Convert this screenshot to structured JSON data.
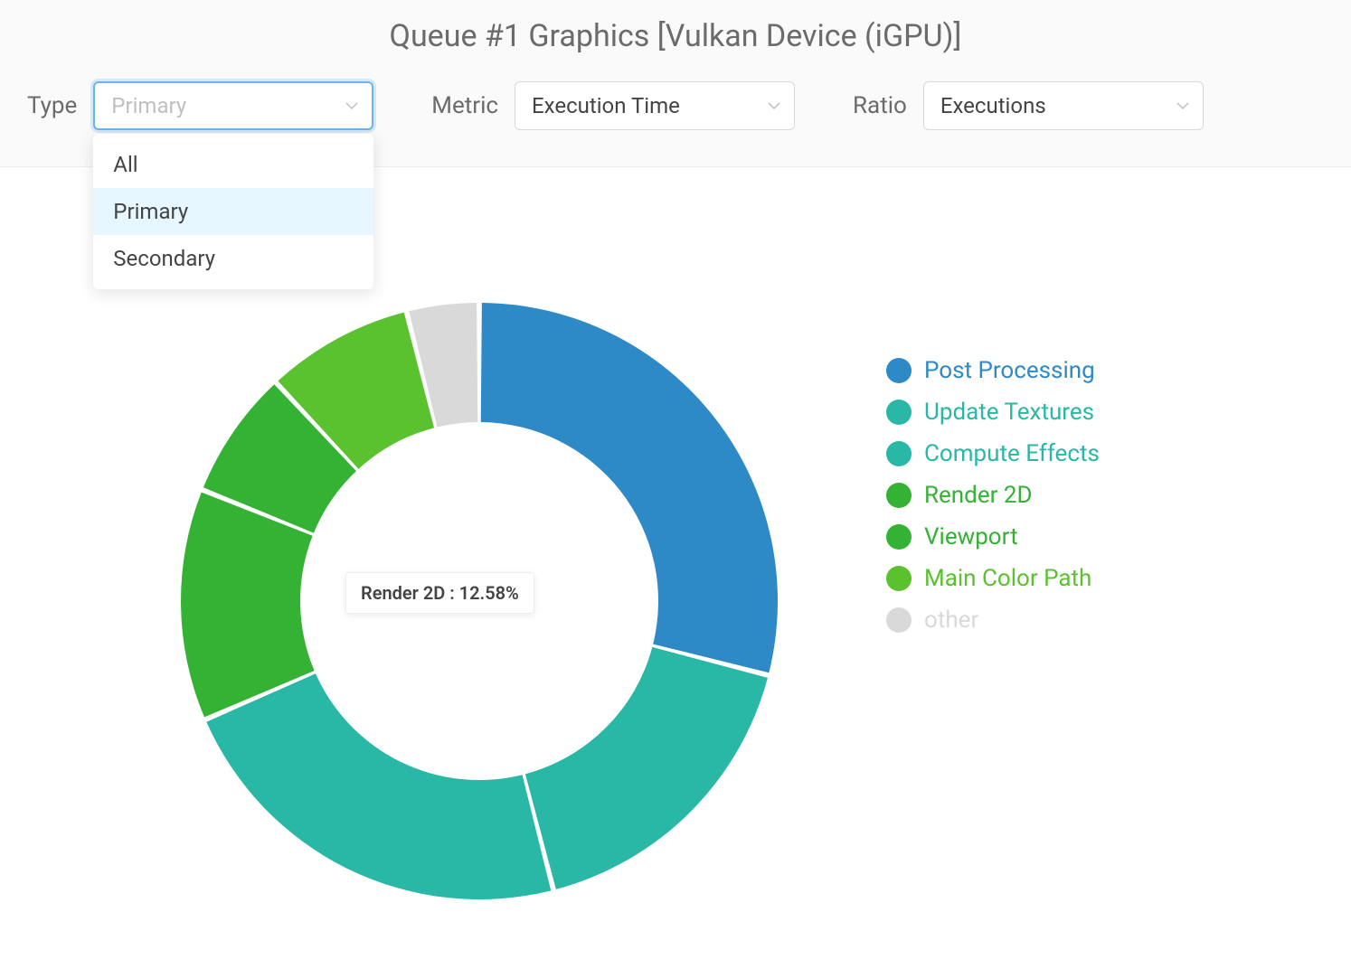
{
  "title": "Queue #1 Graphics  [Vulkan Device (iGPU)]",
  "controls": {
    "type_label": "Type",
    "type_value": "Primary",
    "type_options": [
      "All",
      "Primary",
      "Secondary"
    ],
    "metric_label": "Metric",
    "metric_value": "Execution Time",
    "ratio_label": "Ratio",
    "ratio_value": "Executions"
  },
  "tooltip": "Render 2D : 12.58%",
  "legend": [
    {
      "label": "Post Processing",
      "color": "#2d8ac7"
    },
    {
      "label": "Update Textures",
      "color": "#29b8a5"
    },
    {
      "label": "Compute Effects",
      "color": "#29b8a5"
    },
    {
      "label": "Render 2D",
      "color": "#34b233"
    },
    {
      "label": "Viewport",
      "color": "#34b233"
    },
    {
      "label": "Main Color Path",
      "color": "#5ac12f"
    },
    {
      "label": "other",
      "color": "#d9d9d9"
    }
  ],
  "chart_data": {
    "type": "pie",
    "title": "Queue #1 Graphics  [Vulkan Device (iGPU)]",
    "series": [
      {
        "name": "Post Processing",
        "value": 29.0,
        "color": "#2d8ac7"
      },
      {
        "name": "Update Textures",
        "value": 17.0,
        "color": "#29b8a5"
      },
      {
        "name": "Compute Effects",
        "value": 22.5,
        "color": "#29b8a5"
      },
      {
        "name": "Render 2D",
        "value": 12.58,
        "color": "#34b233"
      },
      {
        "name": "Viewport",
        "value": 7.0,
        "color": "#34b233"
      },
      {
        "name": "Main Color Path",
        "value": 8.0,
        "color": "#5ac12f"
      },
      {
        "name": "other",
        "value": 3.92,
        "color": "#d9d9d9"
      }
    ],
    "xlabel": "",
    "ylabel": "",
    "donut": true
  }
}
